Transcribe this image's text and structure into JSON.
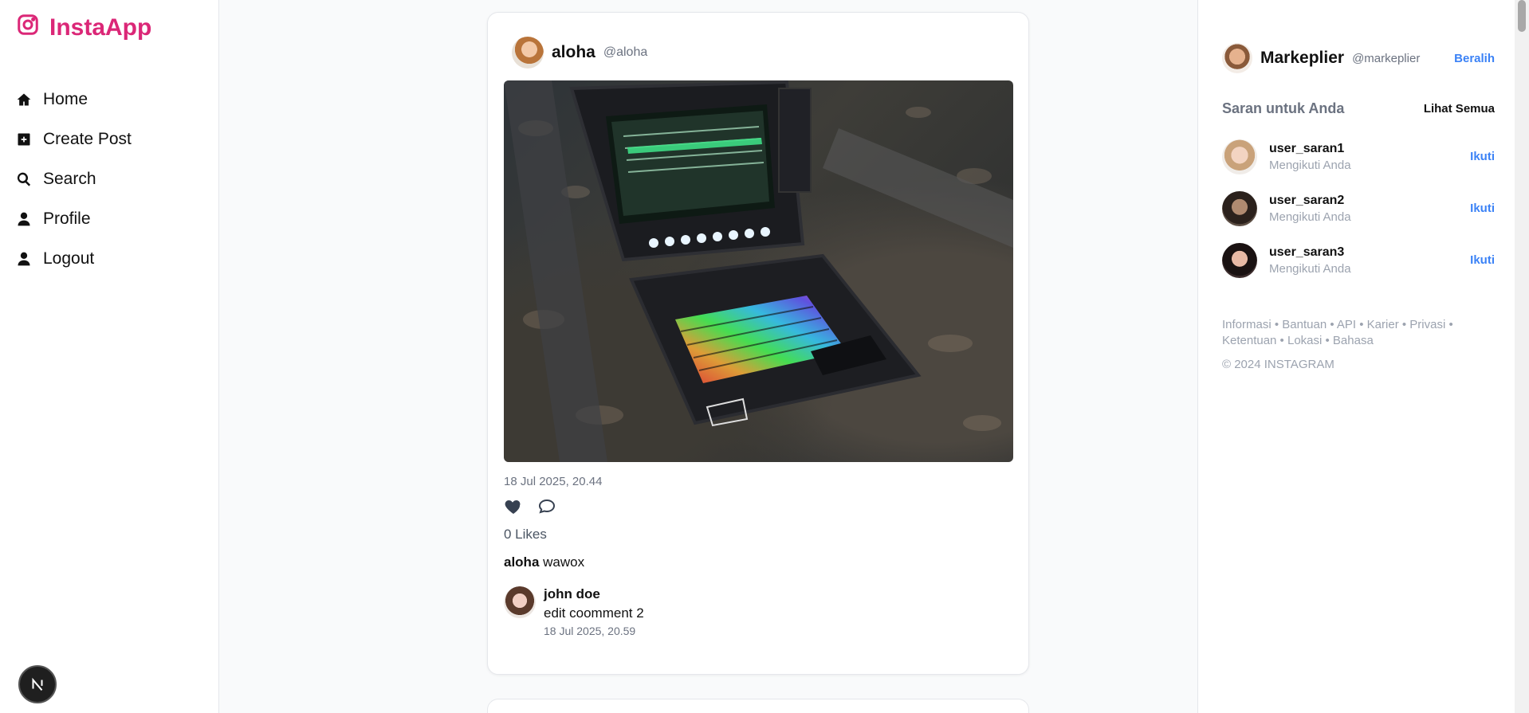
{
  "app": {
    "name": "InstaApp",
    "brand_color": "#db2777",
    "logo_icon": "instagram-icon"
  },
  "sidebar": {
    "items": [
      {
        "label": "Home",
        "icon": "home-icon"
      },
      {
        "label": "Create Post",
        "icon": "plus-square-icon"
      },
      {
        "label": "Search",
        "icon": "search-icon"
      },
      {
        "label": "Profile",
        "icon": "user-icon"
      },
      {
        "label": "Logout",
        "icon": "user-icon"
      }
    ],
    "bottom_badge": "N"
  },
  "post": {
    "username": "aloha",
    "handle": "@aloha",
    "timestamp": "18 Jul 2025, 20.44",
    "likes_text": "0 Likes",
    "caption_user": "aloha",
    "caption_text": "wawox",
    "image_subject": "rugged portable case computer with RGB keyboard",
    "comments": [
      {
        "name": "john doe",
        "text": "edit coomment 2",
        "time": "18 Jul 2025, 20.59"
      }
    ]
  },
  "right": {
    "me": {
      "name": "Markeplier",
      "handle": "@markeplier",
      "switch_label": "Beralih"
    },
    "suggestions_title": "Saran untuk Anda",
    "see_all": "Lihat Semua",
    "suggestions": [
      {
        "name": "user_saran1",
        "sub": "Mengikuti Anda",
        "action": "Ikuti"
      },
      {
        "name": "user_saran2",
        "sub": "Mengikuti Anda",
        "action": "Ikuti"
      },
      {
        "name": "user_saran3",
        "sub": "Mengikuti Anda",
        "action": "Ikuti"
      }
    ],
    "footer_links": "Informasi • Bantuan • API • Karier • Privasi • Ketentuan • Lokasi • Bahasa",
    "copyright": "© 2024 INSTAGRAM"
  },
  "colors": {
    "accent": "#3b82f6",
    "muted": "#6b7280"
  }
}
